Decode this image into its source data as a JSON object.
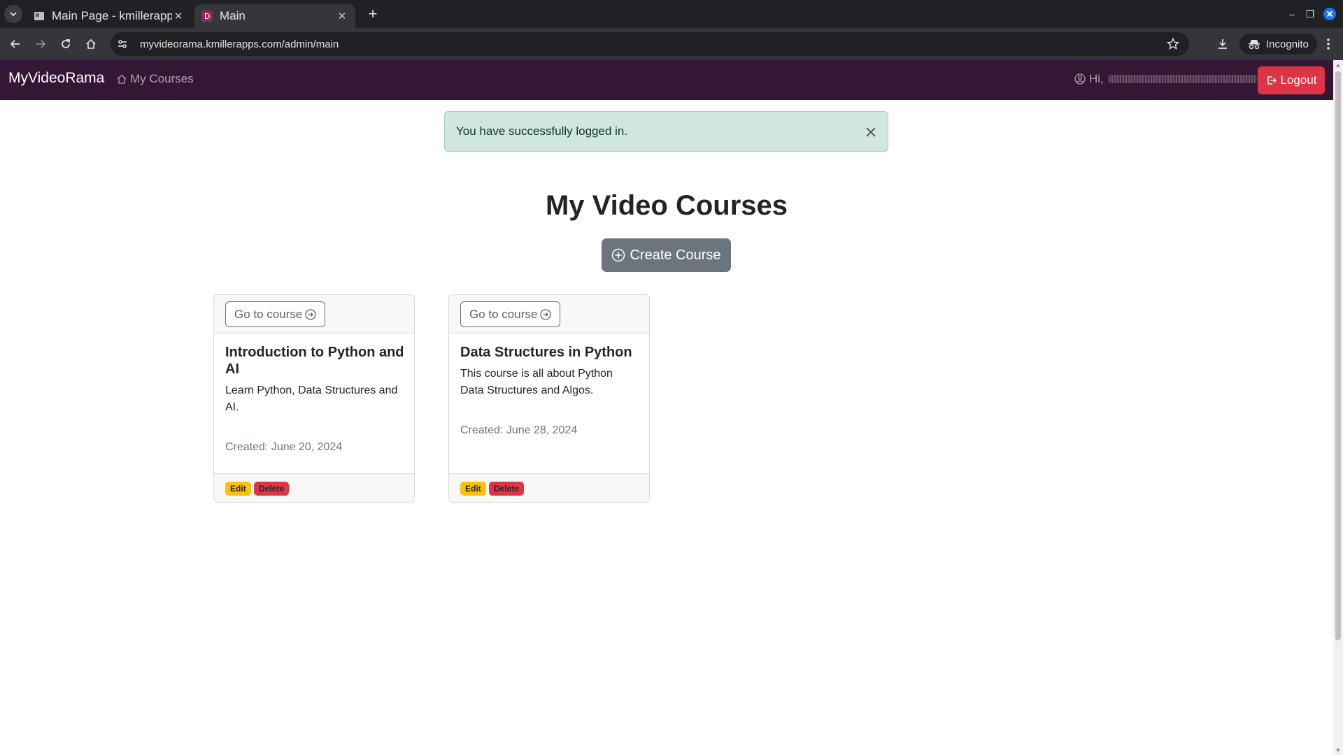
{
  "browser": {
    "tabs": [
      {
        "title": "Main Page - kmillerapps",
        "active": false
      },
      {
        "title": "Main",
        "active": true
      }
    ],
    "url": "myvideorama.kmillerapps.com/admin/main",
    "incognito_label": "Incognito",
    "window_controls": {
      "minimize": "–",
      "restore": "❐",
      "close": "✕"
    },
    "new_tab": "+",
    "tab_close": "✕",
    "tab_list_icon": "chevron-down-icon"
  },
  "nav": {
    "brand": "MyVideoRama",
    "my_courses": "My Courses",
    "greeting": "Hi,",
    "logout": "Logout",
    "bar_color": "#341734"
  },
  "alert": {
    "message": "You have successfully logged in."
  },
  "main": {
    "title": "My Video Courses",
    "create_button": "Create Course"
  },
  "courses": [
    {
      "go_label": "Go to course",
      "title": "Introduction to Python and AI",
      "description": "Learn Python, Data Structures and AI.",
      "created": "Created: June 20, 2024",
      "edit": "Edit",
      "delete": "Delete"
    },
    {
      "go_label": "Go to course",
      "title": "Data Structures in Python",
      "description": "This course is all about Python Data Structures and Algos.",
      "created": "Created: June 28, 2024",
      "edit": "Edit",
      "delete": "Delete"
    }
  ],
  "colors": {
    "danger": "#dc3545",
    "warning": "#ffc107",
    "secondary": "#6c757d",
    "success_bg": "#d1e7dd"
  }
}
